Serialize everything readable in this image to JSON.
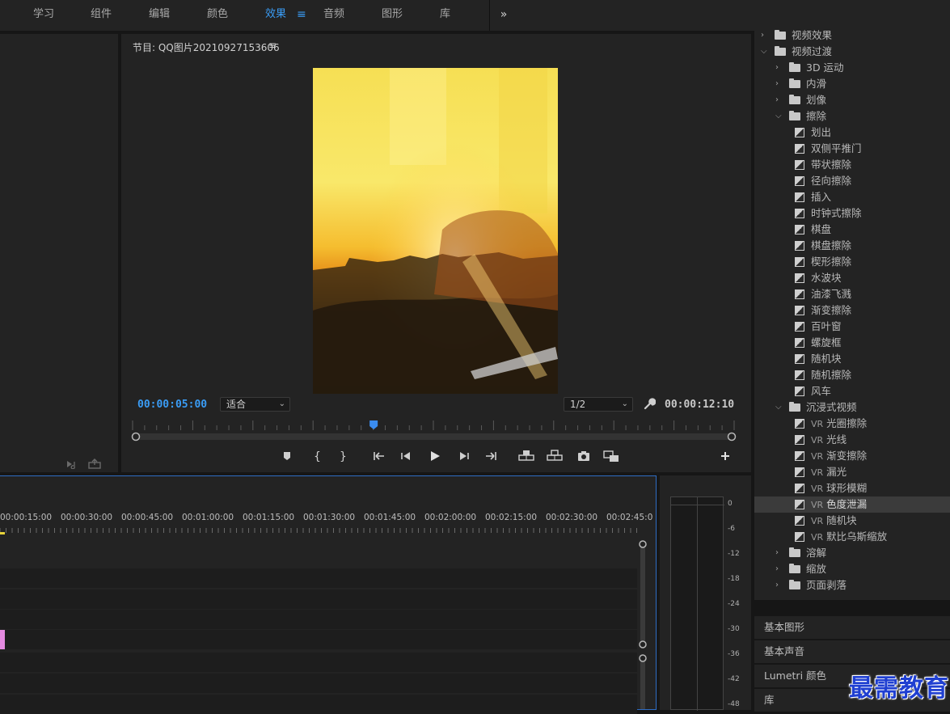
{
  "workspaces": [
    {
      "label": "学习"
    },
    {
      "label": "组件"
    },
    {
      "label": "编辑"
    },
    {
      "label": "颜色"
    },
    {
      "label": "效果",
      "active": true
    },
    {
      "label": "音频"
    },
    {
      "label": "图形"
    },
    {
      "label": "库"
    }
  ],
  "workspace_menu_icon": "hamburger-icon",
  "workspace_more": "»",
  "program": {
    "title": "节目: QQ图片20210927153606",
    "menu": "≡",
    "timecode_current": "00:00:05:00",
    "timecode_duration": "00:00:12:10",
    "fit_label": "适合",
    "resolution_label": "1/2",
    "playhead_fraction": 0.401
  },
  "effects_tree": [
    {
      "label": "视频效果",
      "level": 0,
      "kind": "folder",
      "open": false
    },
    {
      "label": "视频过渡",
      "level": 0,
      "kind": "folder",
      "open": true
    },
    {
      "label": "3D 运动",
      "level": 1,
      "kind": "folder",
      "open": false
    },
    {
      "label": "内滑",
      "level": 1,
      "kind": "folder",
      "open": false
    },
    {
      "label": "划像",
      "level": 1,
      "kind": "folder",
      "open": false
    },
    {
      "label": "擦除",
      "level": 1,
      "kind": "folder",
      "open": true
    },
    {
      "label": "划出",
      "level": 2,
      "kind": "fx"
    },
    {
      "label": "双侧平推门",
      "level": 2,
      "kind": "fx"
    },
    {
      "label": "带状擦除",
      "level": 2,
      "kind": "fx"
    },
    {
      "label": "径向擦除",
      "level": 2,
      "kind": "fx"
    },
    {
      "label": "插入",
      "level": 2,
      "kind": "fx"
    },
    {
      "label": "时钟式擦除",
      "level": 2,
      "kind": "fx"
    },
    {
      "label": "棋盘",
      "level": 2,
      "kind": "fx"
    },
    {
      "label": "棋盘擦除",
      "level": 2,
      "kind": "fx"
    },
    {
      "label": "楔形擦除",
      "level": 2,
      "kind": "fx"
    },
    {
      "label": "水波块",
      "level": 2,
      "kind": "fx"
    },
    {
      "label": "油漆飞溅",
      "level": 2,
      "kind": "fx"
    },
    {
      "label": "渐变擦除",
      "level": 2,
      "kind": "fx"
    },
    {
      "label": "百叶窗",
      "level": 2,
      "kind": "fx"
    },
    {
      "label": "螺旋框",
      "level": 2,
      "kind": "fx"
    },
    {
      "label": "随机块",
      "level": 2,
      "kind": "fx"
    },
    {
      "label": "随机擦除",
      "level": 2,
      "kind": "fx"
    },
    {
      "label": "风车",
      "level": 2,
      "kind": "fx"
    },
    {
      "label": "沉浸式视频",
      "level": 1,
      "kind": "folder",
      "open": true
    },
    {
      "label": "光圈擦除",
      "level": 2,
      "kind": "fx",
      "prefix": "VR"
    },
    {
      "label": "光线",
      "level": 2,
      "kind": "fx",
      "prefix": "VR"
    },
    {
      "label": "渐变擦除",
      "level": 2,
      "kind": "fx",
      "prefix": "VR"
    },
    {
      "label": "漏光",
      "level": 2,
      "kind": "fx",
      "prefix": "VR"
    },
    {
      "label": "球形模糊",
      "level": 2,
      "kind": "fx",
      "prefix": "VR"
    },
    {
      "label": "色度泄漏",
      "level": 2,
      "kind": "fx",
      "prefix": "VR",
      "selected": true
    },
    {
      "label": "随机块",
      "level": 2,
      "kind": "fx",
      "prefix": "VR"
    },
    {
      "label": "默比乌斯缩放",
      "level": 2,
      "kind": "fx",
      "prefix": "VR"
    },
    {
      "label": "溶解",
      "level": 1,
      "kind": "folder",
      "open": false
    },
    {
      "label": "缩放",
      "level": 1,
      "kind": "folder",
      "open": false
    },
    {
      "label": "页面剥落",
      "level": 1,
      "kind": "folder",
      "open": false
    }
  ],
  "collapsed_panels": [
    {
      "label": "基本图形"
    },
    {
      "label": "基本声音"
    },
    {
      "label": "Lumetri 颜色"
    },
    {
      "label": "库"
    }
  ],
  "timeline": {
    "ruler_labels": [
      "00:00:15:00",
      "00:00:30:00",
      "00:00:45:00",
      "00:01:00:00",
      "00:01:15:00",
      "00:01:30:00",
      "00:01:45:00",
      "00:02:00:00",
      "00:02:15:00",
      "00:02:30:00",
      "00:02:45:0"
    ]
  },
  "meter_scale": [
    "0",
    "-6",
    "-12",
    "-18",
    "-24",
    "-30",
    "-36",
    "-42",
    "-48"
  ],
  "watermark": "最需教育",
  "colors": {
    "accent": "#3a9cf5",
    "panel": "#232323",
    "clip": "#e48ae0"
  }
}
